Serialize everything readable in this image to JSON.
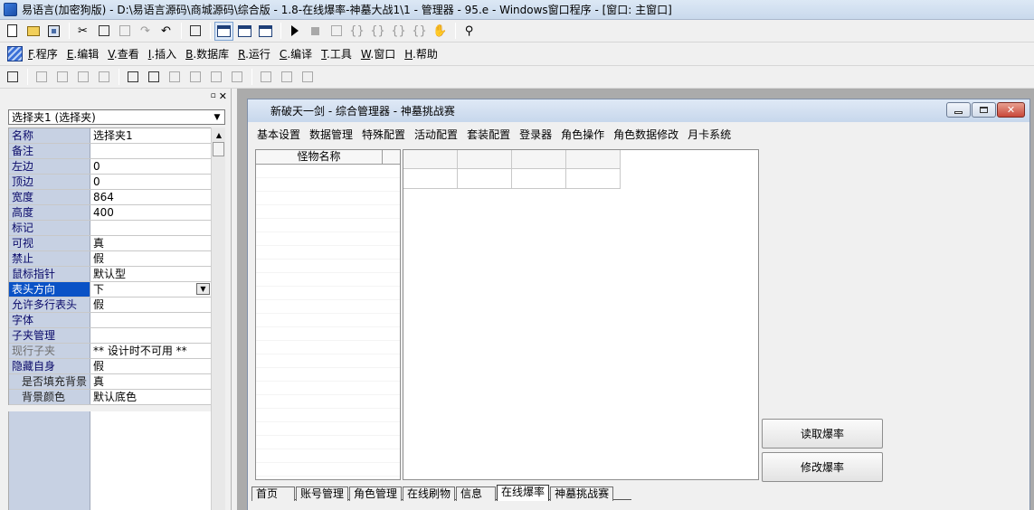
{
  "ide": {
    "title": "易语言(加密狗版) - D:\\易语言源码\\商城源码\\综合版 - 1.8-在线爆率-神墓大战1\\1 - 管理器 - 95.e - Windows窗口程序 - [窗口: 主窗口]"
  },
  "menu": [
    {
      "key": "F",
      "label": ".程序"
    },
    {
      "key": "E",
      "label": ".编辑"
    },
    {
      "key": "V",
      "label": ".查看"
    },
    {
      "key": "I",
      "label": ".插入"
    },
    {
      "key": "B",
      "label": ".数据库"
    },
    {
      "key": "R",
      "label": ".运行"
    },
    {
      "key": "C",
      "label": ".编译"
    },
    {
      "key": "T",
      "label": ".工具"
    },
    {
      "key": "W",
      "label": ".窗口"
    },
    {
      "key": "H",
      "label": ".帮助"
    }
  ],
  "properties": {
    "component_selector": "选择夹1 (选择夹)",
    "rows": [
      {
        "name": "名称",
        "value": "选择夹1"
      },
      {
        "name": "备注",
        "value": ""
      },
      {
        "name": "左边",
        "value": "0"
      },
      {
        "name": "顶边",
        "value": "0"
      },
      {
        "name": "宽度",
        "value": "864"
      },
      {
        "name": "高度",
        "value": "400"
      },
      {
        "name": "标记",
        "value": ""
      },
      {
        "name": "可视",
        "value": "真"
      },
      {
        "name": "禁止",
        "value": "假"
      },
      {
        "name": "鼠标指针",
        "value": "默认型"
      },
      {
        "name": "表头方向",
        "value": "下"
      },
      {
        "name": "允许多行表头",
        "value": "假"
      },
      {
        "name": "字体",
        "value": ""
      },
      {
        "name": "子夹管理",
        "value": ""
      },
      {
        "name": "现行子夹",
        "value": "** 设计时不可用 **"
      },
      {
        "name": "隐藏自身",
        "value": "假"
      },
      {
        "name": "是否填充背景",
        "value": "真"
      },
      {
        "name": "背景颜色",
        "value": "默认底色"
      }
    ]
  },
  "designer": {
    "window_title": "新破天一剑 - 综合管理器 - 神墓挑战赛",
    "menu": [
      "基本设置",
      "数据管理",
      "特殊配置",
      "活动配置",
      "套装配置",
      "登录器",
      "角色操作",
      "角色数据修改",
      "月卡系统"
    ],
    "list_header": "怪物名称",
    "read_button": "读取爆率",
    "modify_button": "修改爆率",
    "tabs": [
      "首页",
      "账号管理",
      "角色管理",
      "在线刷物",
      "信息",
      "在线爆率",
      "神墓挑战赛"
    ],
    "active_tab": "在线爆率"
  },
  "colors": {
    "selected_row": "#0a52c6",
    "property_name_bg": "#c7d1e3",
    "design_area_bg": "#ababab"
  }
}
